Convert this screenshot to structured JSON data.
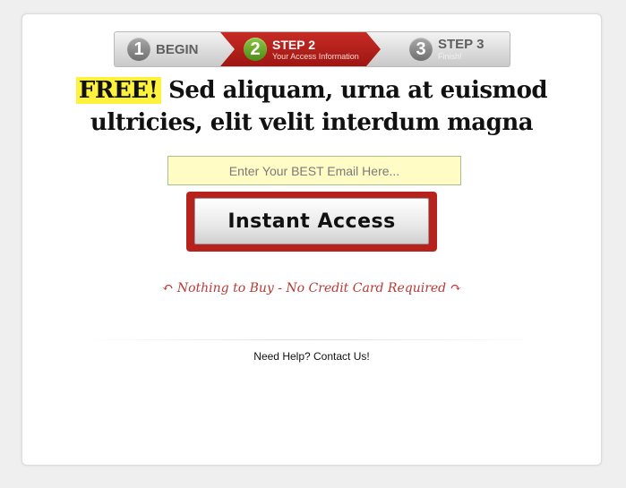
{
  "steps": [
    {
      "number": "1",
      "title": "BEGIN",
      "subtitle": ""
    },
    {
      "number": "2",
      "title": "STEP 2",
      "subtitle": "Your Access Information"
    },
    {
      "number": "3",
      "title": "STEP 3",
      "subtitle": "Finish!"
    }
  ],
  "headline": {
    "highlight": "FREE!",
    "text": "Sed aliquam, urna at euismod ultricies, elit velit interdum magna"
  },
  "email": {
    "placeholder": "Enter Your BEST Email Here...",
    "value": ""
  },
  "cta": {
    "label": "Instant Access"
  },
  "notice": {
    "text": "Nothing to Buy - No Credit Card Required"
  },
  "help": {
    "text": "Need Help? Contact Us!"
  },
  "colors": {
    "accent": "#b7221d",
    "highlight": "#fff23d",
    "input_bg": "#fffcc5",
    "step_active": "#8cc63f"
  }
}
